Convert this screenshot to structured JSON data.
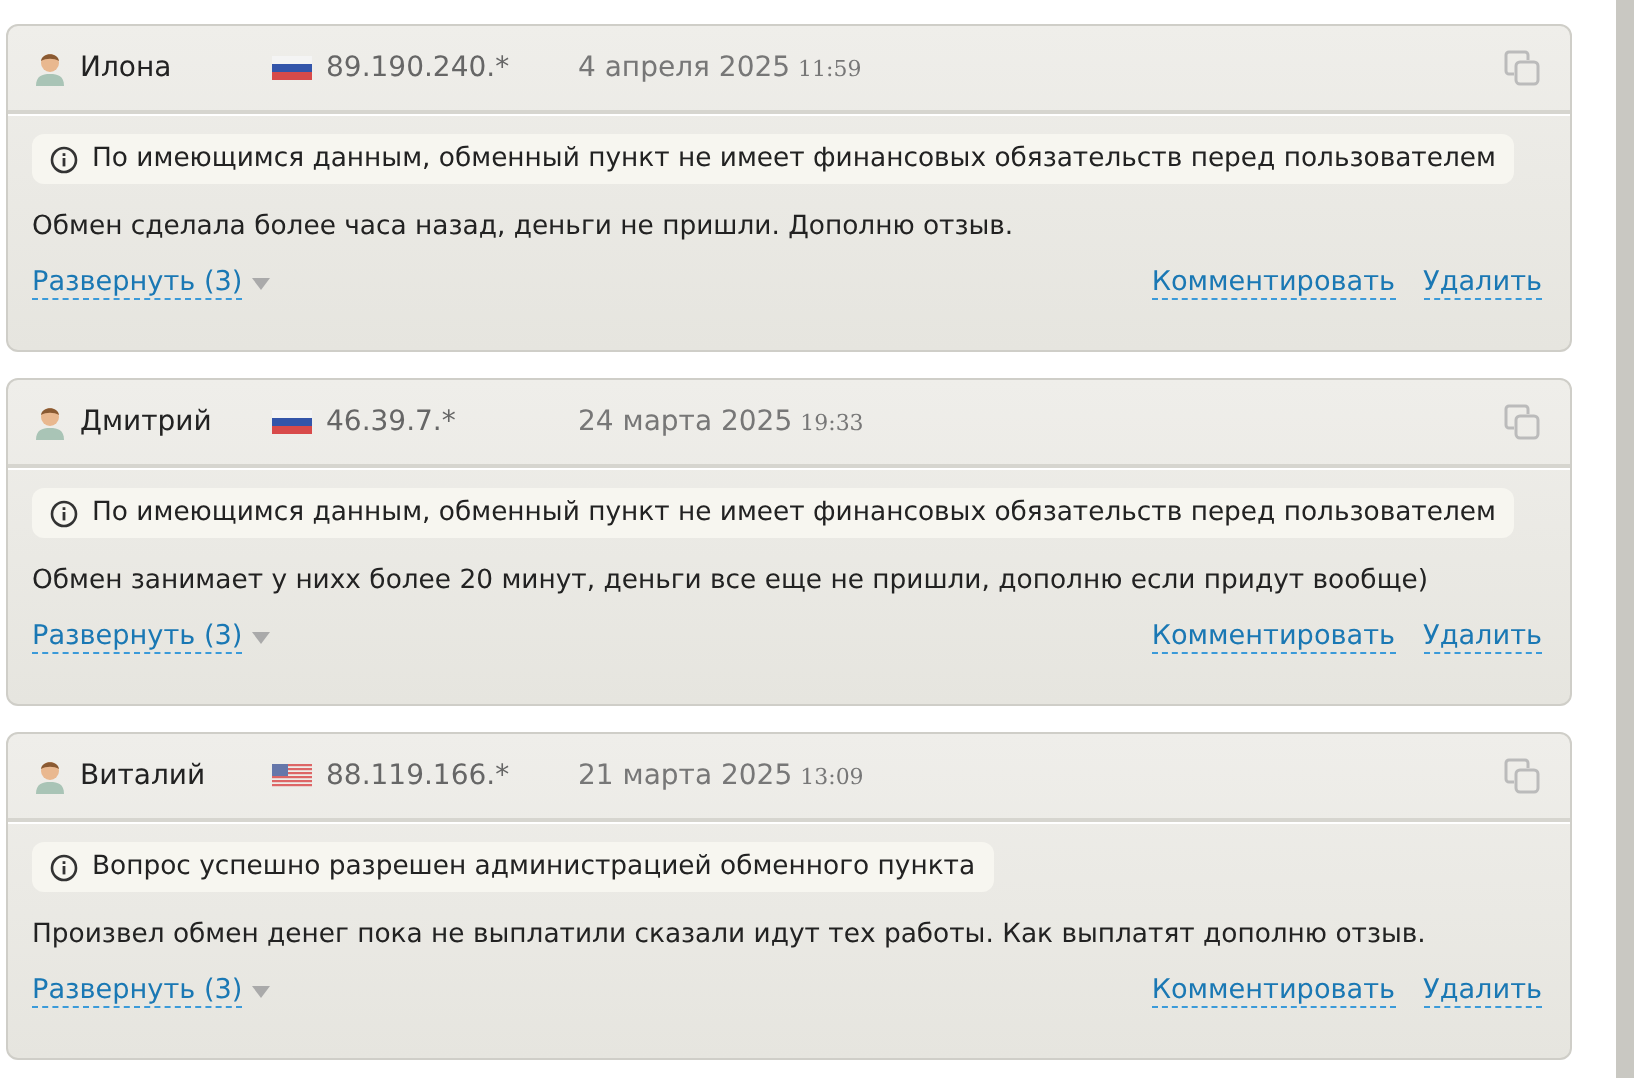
{
  "reviews": [
    {
      "author": "Илона",
      "flag": {
        "kind": "ru"
      },
      "ip": "89.190.240.*",
      "date": "4 апреля 2025",
      "time": "11:59",
      "notice": "По имеющимся данным, обменный пункт не имеет финансовых обязательств перед пользователем",
      "text": "Обмен сделала более часа назад, деньги не пришли. Дополню отзыв.",
      "expand": "Развернуть (3)",
      "actions": [
        "Комментировать",
        "Удалить"
      ]
    },
    {
      "author": "Дмитрий",
      "flag": {
        "kind": "ru"
      },
      "ip": "46.39.7.*",
      "date": "24 марта 2025",
      "time": "19:33",
      "notice": "По имеющимся данным, обменный пункт не имеет финансовых обязательств перед пользователем",
      "text": "Обмен занимает у нихх более 20 минут, деньги все еще не пришли, дополню если придут вообще)",
      "expand": "Развернуть (3)",
      "actions": [
        "Комментировать",
        "Удалить"
      ]
    },
    {
      "author": "Виталий",
      "flag": {
        "kind": "us"
      },
      "ip": "88.119.166.*",
      "date": "21 марта 2025",
      "time": "13:09",
      "notice": "Вопрос успешно разрешен администрацией обменного пункта",
      "text": "Произвел обмен денег пока не выплатили сказали идут тех работы. Как выплатят дополню отзыв.",
      "expand": "Развернуть (3)",
      "actions": [
        "Комментировать",
        "Удалить"
      ]
    }
  ]
}
